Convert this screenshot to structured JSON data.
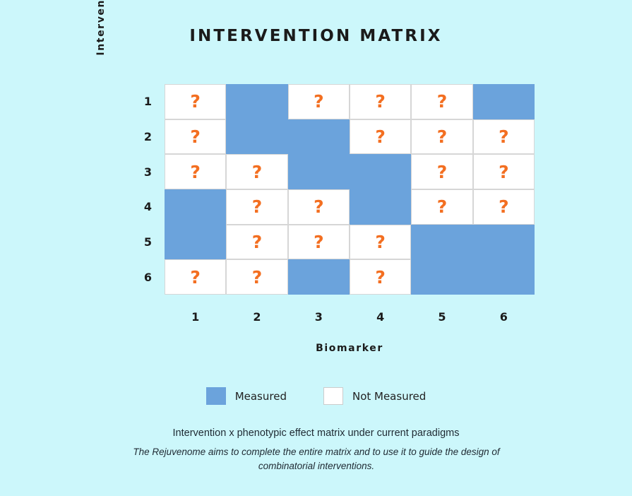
{
  "title": "INTERVENTION MATRIX",
  "background_color": "#ccf7fb",
  "colors": {
    "measured": "#6ba3dc",
    "not_measured": "#ffffff",
    "question_mark": "#f36f21",
    "text": "#1b1b1b",
    "background": "#ccf7fb",
    "cell_border": "#d6d6d6"
  },
  "axes": {
    "x_label": "Biomarker",
    "y_label": "Intervention",
    "x_ticks": [
      "1",
      "2",
      "3",
      "4",
      "5",
      "6"
    ],
    "y_ticks": [
      "1",
      "2",
      "3",
      "4",
      "5",
      "6"
    ]
  },
  "legend": {
    "items": [
      {
        "label": "Measured",
        "state": "measured"
      },
      {
        "label": "Not Measured",
        "state": "not_measured"
      }
    ]
  },
  "cell_marker": "?",
  "captions": {
    "primary": "Intervention x phenotypic effect matrix under current paradigms",
    "secondary": "The Rejuvenome aims to complete the entire matrix and to use it to guide the design of combinatorial interventions."
  },
  "chart_data": {
    "type": "heatmap",
    "title": "INTERVENTION MATRIX",
    "xlabel": "Biomarker",
    "ylabel": "Intervention",
    "categories_x": [
      "1",
      "2",
      "3",
      "4",
      "5",
      "6"
    ],
    "categories_y": [
      "1",
      "2",
      "3",
      "4",
      "5",
      "6"
    ],
    "value_encoding": {
      "1": "measured",
      "0": "not_measured (displayed with an orange question mark)"
    },
    "legend_position": "bottom-center",
    "grid": true,
    "values": [
      [
        0,
        1,
        0,
        0,
        0,
        1
      ],
      [
        0,
        1,
        1,
        0,
        0,
        0
      ],
      [
        0,
        0,
        1,
        1,
        0,
        0
      ],
      [
        1,
        0,
        0,
        1,
        0,
        0
      ],
      [
        1,
        0,
        0,
        0,
        1,
        1
      ],
      [
        0,
        0,
        1,
        0,
        1,
        1
      ]
    ],
    "rows": [
      {
        "intervention": "1",
        "cells": [
          "not_measured",
          "measured",
          "not_measured",
          "not_measured",
          "not_measured",
          "measured"
        ]
      },
      {
        "intervention": "2",
        "cells": [
          "not_measured",
          "measured",
          "measured",
          "not_measured",
          "not_measured",
          "not_measured"
        ]
      },
      {
        "intervention": "3",
        "cells": [
          "not_measured",
          "not_measured",
          "measured",
          "measured",
          "not_measured",
          "not_measured"
        ]
      },
      {
        "intervention": "4",
        "cells": [
          "measured",
          "not_measured",
          "not_measured",
          "measured",
          "not_measured",
          "not_measured"
        ]
      },
      {
        "intervention": "5",
        "cells": [
          "measured",
          "not_measured",
          "not_measured",
          "not_measured",
          "measured",
          "measured"
        ]
      },
      {
        "intervention": "6",
        "cells": [
          "not_measured",
          "not_measured",
          "measured",
          "not_measured",
          "measured",
          "measured"
        ]
      }
    ],
    "measured_count": 14,
    "not_measured_count": 22,
    "total_cells": 36
  }
}
